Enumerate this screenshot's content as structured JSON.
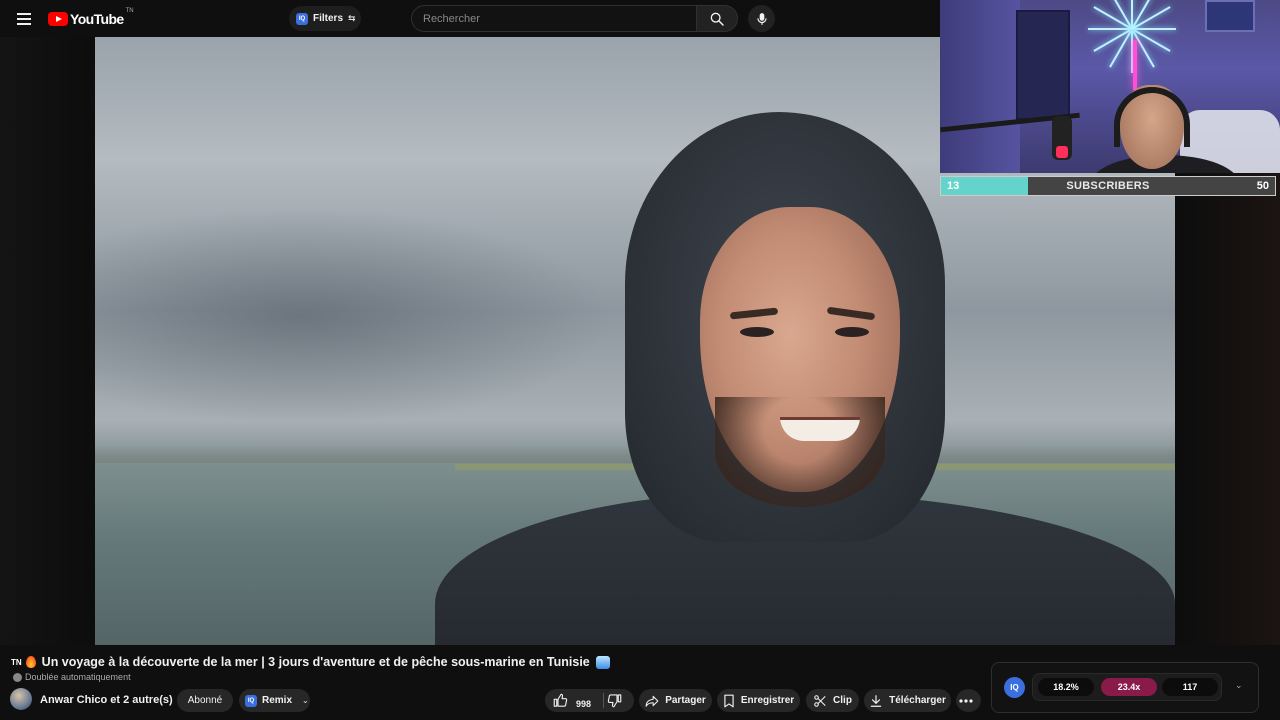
{
  "header": {
    "logo_text": "YouTube",
    "logo_sup": "TN",
    "filters_label": "Filters",
    "filters_badge": "IQ",
    "search_placeholder": "Rechercher"
  },
  "stream_overlay": {
    "subscribers_label": "SUBSCRIBERS",
    "current": "13",
    "goal": "50",
    "progress": 0.26,
    "accent": "#63d3cb"
  },
  "video": {
    "title_prefix": "TN",
    "title": "Un voyage à la découverte de la mer | 3 jours d'aventure et de pêche sous-marine en Tunisie",
    "dubbed": "Doublée automatiquement"
  },
  "channel": {
    "name": "Anwar Chico et 2 autre(s)",
    "subscribe_state": "Abonné",
    "remix_badge": "IQ",
    "remix_label": "Remix"
  },
  "actions": {
    "likes": "998",
    "share": "Partager",
    "save": "Enregistrer",
    "clip": "Clip",
    "download": "Télécharger"
  },
  "iq_widget": {
    "logo": "IQ",
    "stats": [
      "18.2%",
      "23.4x",
      "117"
    ],
    "highlight_color": "#8a1a4a"
  }
}
